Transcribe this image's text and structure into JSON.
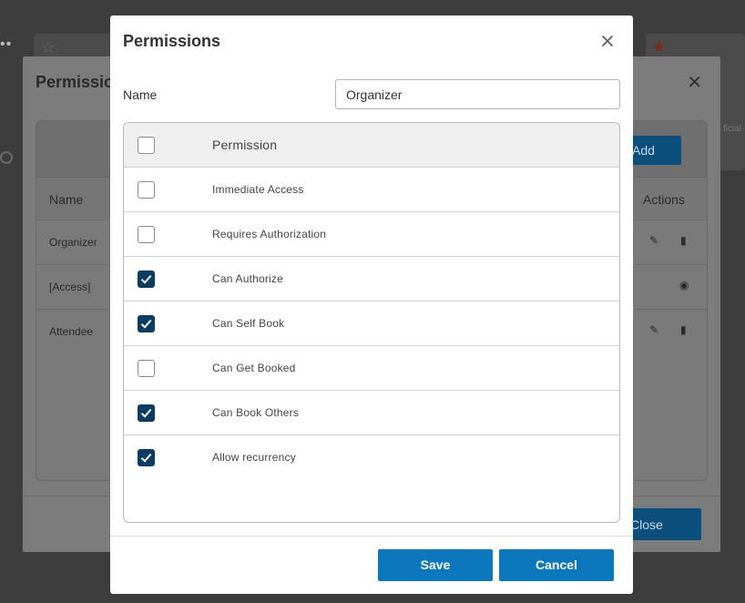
{
  "background": {
    "dialog_title": "Permissions",
    "add_label": "Add",
    "close_label": "Close",
    "side_text": "ficial",
    "columns": {
      "name": "Name",
      "actions": "Actions"
    },
    "rows": [
      {
        "name": "Organizer",
        "actions": [
          "edit-icon",
          "trash-icon"
        ]
      },
      {
        "name": "[Access]",
        "actions": [
          "eye-icon"
        ]
      },
      {
        "name": "Attendee",
        "actions": [
          "edit-icon",
          "trash-icon"
        ]
      }
    ]
  },
  "modal": {
    "title": "Permissions",
    "name_label": "Name",
    "name_value": "Organizer",
    "table": {
      "header_label": "Permission",
      "header_checked": false,
      "rows": [
        {
          "label": "Immediate Access",
          "checked": false
        },
        {
          "label": "Requires Authorization",
          "checked": false
        },
        {
          "label": "Can Authorize",
          "checked": true
        },
        {
          "label": "Can Self Book",
          "checked": true
        },
        {
          "label": "Can Get Booked",
          "checked": false
        },
        {
          "label": "Can Book Others",
          "checked": true
        },
        {
          "label": "Allow recurrency",
          "checked": true
        }
      ]
    },
    "save_label": "Save",
    "cancel_label": "Cancel"
  },
  "colors": {
    "primary_button": "#0b77bd",
    "checkbox_checked": "#0a3d63",
    "overlay": "#3d3d3d"
  }
}
